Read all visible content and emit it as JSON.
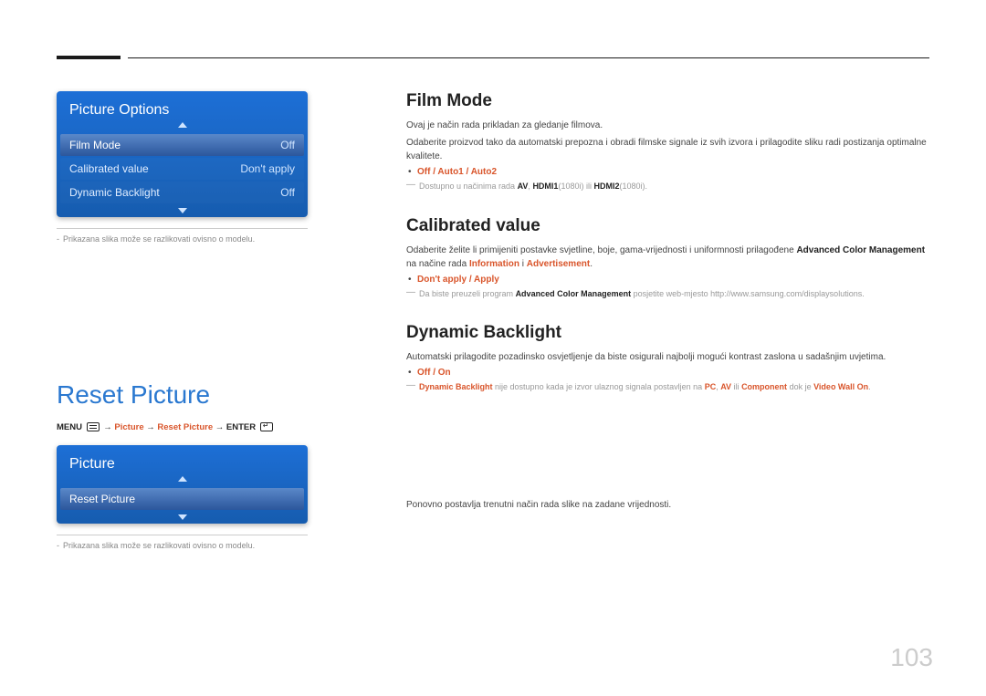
{
  "page_number": "103",
  "top_menu": {
    "title": "Picture Options",
    "rows": [
      {
        "label": "Film Mode",
        "value": "Off",
        "selected": true
      },
      {
        "label": "Calibrated value",
        "value": "Don't apply",
        "selected": false
      },
      {
        "label": "Dynamic Backlight",
        "value": "Off",
        "selected": false
      }
    ],
    "caption": "Prikazana slika može se razlikovati ovisno o modelu."
  },
  "film_mode": {
    "title": "Film Mode",
    "p1": "Ovaj je način rada prikladan za gledanje filmova.",
    "p2": "Odaberite proizvod tako da automatski prepozna i obradi filmske signale iz svih izvora i prilagodite sliku radi postizanja optimalne kvalitete.",
    "opts": "Off / Auto1 / Auto2",
    "foot_pre": "Dostupno u načinima rada ",
    "foot_av": "AV",
    "foot_mid1": ", ",
    "foot_h1": "HDMI1",
    "foot_h1res": "(1080i)",
    "foot_mid2": " ili ",
    "foot_h2": "HDMI2",
    "foot_h2res": "(1080i)."
  },
  "calibrated": {
    "title": "Calibrated value",
    "p_pre": "Odaberite želite li primijeniti postavke svjetline, boje, gama-vrijednosti i uniformnosti prilagođene ",
    "acm": "Advanced Color Management",
    "p_mid": " na načine rada ",
    "info": "Information",
    "and": " i ",
    "adv": "Advertisement",
    "p_end": ".",
    "opts": "Don't apply / Apply",
    "foot_pre": "Da biste preuzeli program ",
    "foot_acm": "Advanced Color Management",
    "foot_post": " posjetite web-mjesto http://www.samsung.com/displaysolutions."
  },
  "dynbl": {
    "title": "Dynamic Backlight",
    "p1": "Automatski prilagodite pozadinsko osvjetljenje da biste osigurali najbolji mogući kontrast zaslona u sadašnjim uvjetima.",
    "opts": "Off / On",
    "foot_a": "Dynamic Backlight",
    "foot_b": " nije dostupno kada je izvor ulaznog signala postavljen na ",
    "foot_pc": "PC",
    "foot_c": ", ",
    "foot_av": "AV",
    "foot_d": " ili ",
    "foot_comp": "Component",
    "foot_e": " dok je ",
    "foot_vw": "Video Wall On",
    "foot_f": "."
  },
  "reset": {
    "heading": "Reset Picture",
    "bc_menu": "MENU",
    "bc_arrow": " → ",
    "bc_picture": "Picture",
    "bc_reset": "Reset Picture",
    "bc_enter": "ENTER",
    "desc": "Ponovno postavlja trenutni način rada slike na zadane vrijednosti."
  },
  "bottom_menu": {
    "title": "Picture",
    "rows": [
      {
        "label": "Reset Picture",
        "value": "",
        "selected": true
      }
    ],
    "caption": "Prikazana slika može se razlikovati ovisno o modelu."
  }
}
